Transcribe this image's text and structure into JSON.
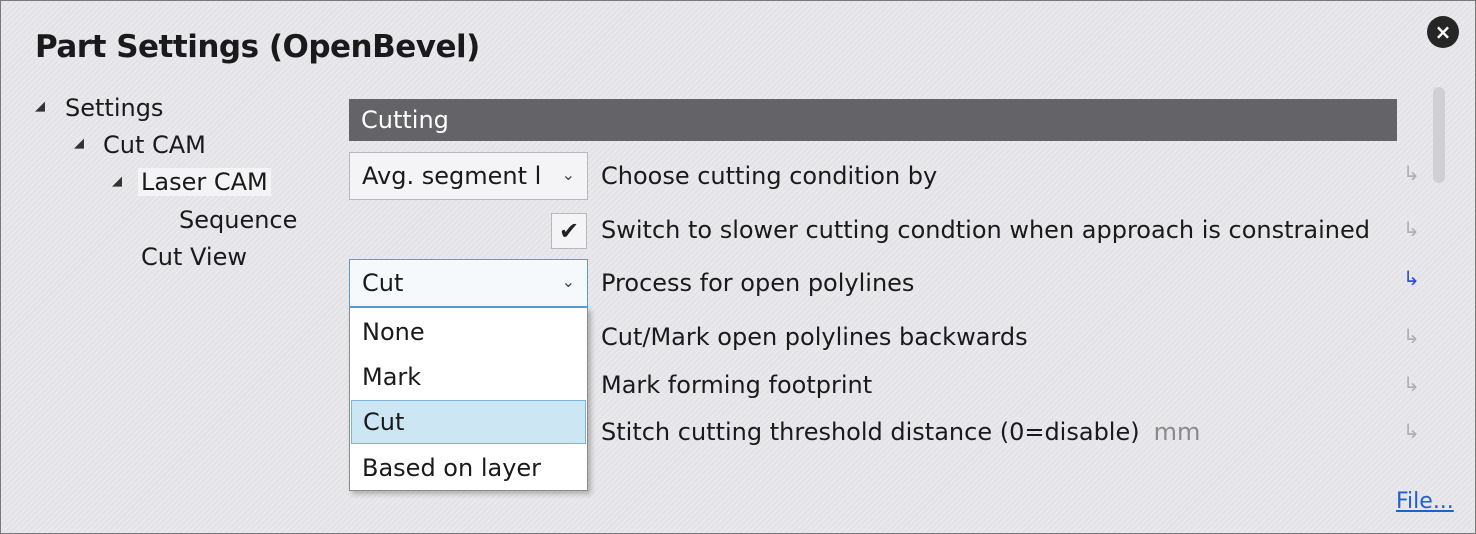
{
  "window": {
    "title": "Part Settings (OpenBevel)",
    "close_icon": "×"
  },
  "tree": {
    "items": [
      {
        "label": "Settings",
        "expanded": true
      },
      {
        "label": "Cut CAM",
        "expanded": true
      },
      {
        "label": "Laser CAM",
        "expanded": true,
        "selected": true
      },
      {
        "label": "Sequence"
      },
      {
        "label": "Cut View"
      }
    ],
    "expanded_icon": "◢"
  },
  "section": {
    "title": "Cutting"
  },
  "settings": {
    "cutting_condition": {
      "value": "Avg. segment l",
      "label": "Choose cutting condition by"
    },
    "slower_condition": {
      "checked": true,
      "check_glyph": "✔",
      "label": "Switch to slower cutting condtion when approach is constrained"
    },
    "open_polylines": {
      "value": "Cut",
      "label": "Process for open polylines"
    },
    "backwards": {
      "label": "Cut/Mark open polylines backwards"
    },
    "footprint": {
      "label": "Mark forming footprint"
    },
    "stitch": {
      "label": "Stitch cutting threshold distance (0=disable)",
      "unit": "mm"
    }
  },
  "dropdown": {
    "options": [
      "None",
      "Mark",
      "Cut",
      "Based on layer"
    ],
    "selected": "Cut"
  },
  "icons": {
    "chevron": "⌄",
    "reset": "↳"
  },
  "colors": {
    "header": "#636368",
    "reset_active": "#2c4fd8",
    "selection": "#cde6f4"
  },
  "footer": {
    "file_link": "File..."
  }
}
